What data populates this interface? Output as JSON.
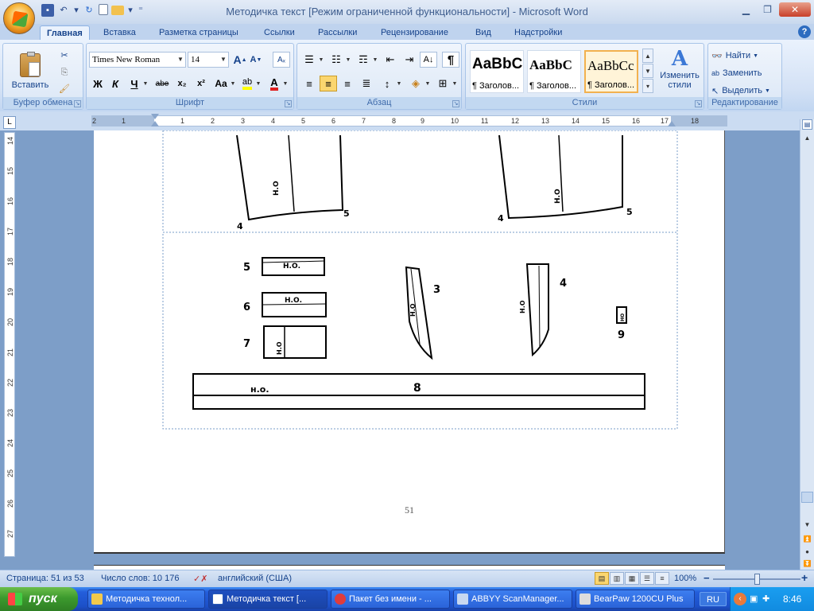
{
  "window": {
    "title": "Методичка текст [Режим ограниченной функциональности] - Microsoft Word"
  },
  "tabs": [
    "Главная",
    "Вставка",
    "Разметка страницы",
    "Ссылки",
    "Рассылки",
    "Рецензирование",
    "Вид",
    "Надстройки"
  ],
  "clipboard": {
    "paste_label": "Вставить",
    "group_label": "Буфер обмена"
  },
  "font": {
    "name": "Times New Roman",
    "size": "14",
    "group_label": "Шрифт",
    "bold": "Ж",
    "italic": "К",
    "underline": "Ч",
    "strike": "abe",
    "sub": "x₂",
    "sup": "x²",
    "case": "Aa",
    "grow": "A",
    "shrink": "A"
  },
  "paragraph": {
    "group_label": "Абзац",
    "pilcrow": "¶"
  },
  "styles": {
    "group_label": "Стили",
    "items": [
      {
        "sample": "AaBbC",
        "name": "¶ Заголов..."
      },
      {
        "sample": "AaBbC",
        "name": "¶ Заголов..."
      },
      {
        "sample": "AaBbCc",
        "name": "¶ Заголов..."
      }
    ],
    "change_label": "Изменить",
    "change_label2": "стили"
  },
  "editing": {
    "find": "Найти",
    "replace": "Заменить",
    "select": "Выделить",
    "group_label": "Редактирование"
  },
  "ruler": {
    "h": [
      "2",
      "1",
      "1",
      "2",
      "3",
      "4",
      "5",
      "6",
      "7",
      "8",
      "9",
      "10",
      "11",
      "12",
      "13",
      "14",
      "15",
      "16",
      "17",
      "18"
    ],
    "v": [
      "14",
      "15",
      "16",
      "17",
      "18",
      "19",
      "20",
      "21",
      "22",
      "23",
      "24",
      "25",
      "26",
      "27"
    ]
  },
  "document": {
    "page_number": "51",
    "labels": {
      "n1": "4",
      "n2": "5",
      "n3": "4",
      "n4": "5",
      "p5": "5",
      "p6": "6",
      "p7": "7",
      "p3": "3",
      "p4": "4",
      "p9": "9",
      "p8": "8",
      "ho": "Н.О.",
      "ho_lower": "н.о.",
      "ho_stack": "Н.О",
      "ho_small": "НО"
    }
  },
  "status": {
    "page": "Страница: 51 из 53",
    "words": "Число слов: 10 176",
    "lang": "английский (США)",
    "zoom": "100%"
  },
  "taskbar": {
    "start": "пуск",
    "items": [
      "Методичка технол...",
      "Методичка текст [...",
      "Пакет без имени - ...",
      "ABBYY ScanManager...",
      "BearPaw 1200CU Plus"
    ],
    "lang": "RU",
    "time": "8:46"
  }
}
